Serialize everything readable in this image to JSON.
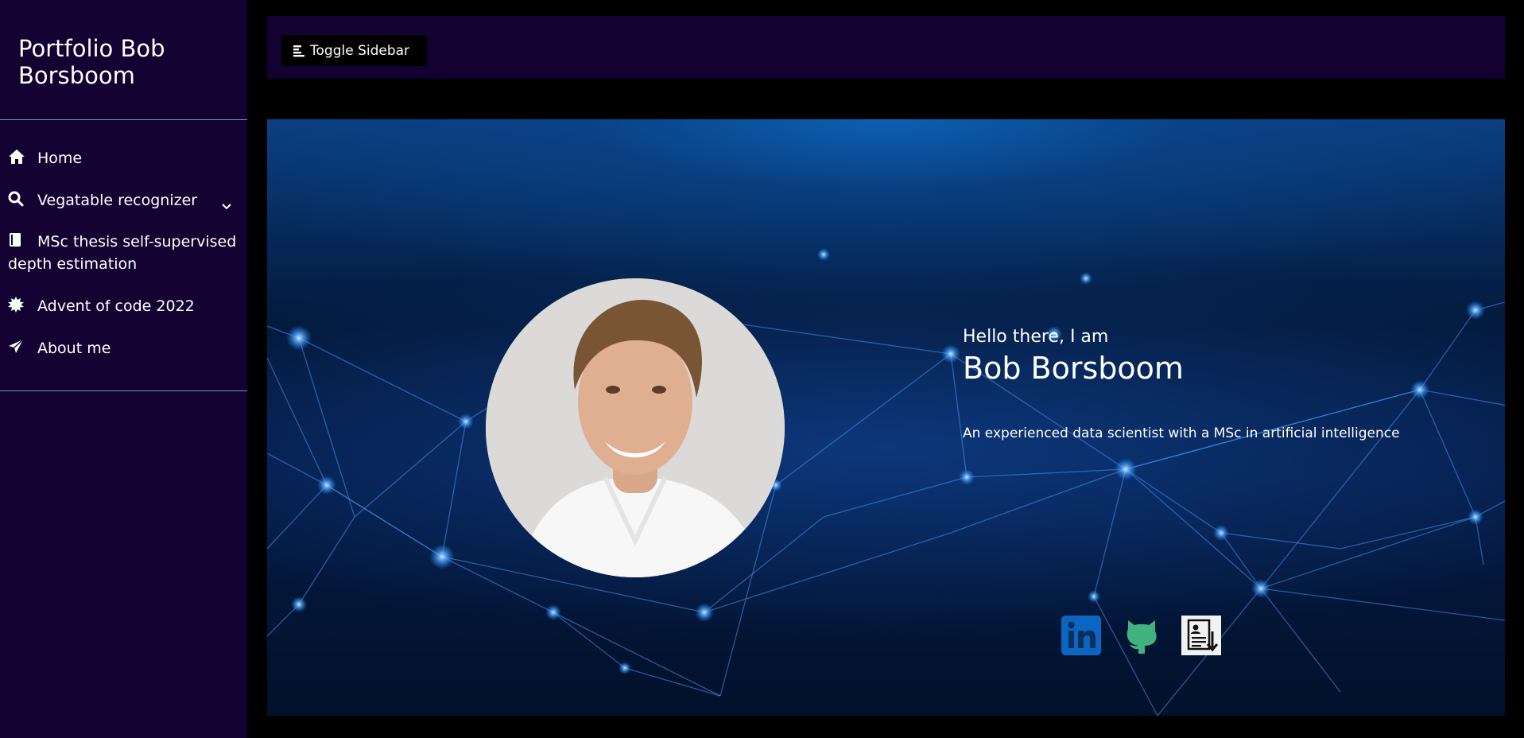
{
  "sidebar": {
    "brand": "Portfolio Bob Borsboom",
    "items": [
      {
        "label": "Home",
        "icon": "home-icon"
      },
      {
        "label": "Vegatable recognizer",
        "icon": "search-icon",
        "has_submenu": true
      },
      {
        "label": "MSc thesis self-supervised depth estimation",
        "icon": "book-icon"
      },
      {
        "label": "Advent of code 2022",
        "icon": "sun-icon"
      },
      {
        "label": "About me",
        "icon": "paper-plane-icon"
      }
    ]
  },
  "topbar": {
    "toggle_label": "Toggle Sidebar"
  },
  "hero": {
    "greeting": "Hello there, I am",
    "name": "Bob Borsboom",
    "tagline": "An experienced data scientist with a MSc in artificial intelligence",
    "social": [
      {
        "icon": "linkedin-icon",
        "color": "#0a66c2"
      },
      {
        "icon": "github-icon",
        "color": "#3fb27f"
      },
      {
        "icon": "resume-download-icon",
        "color": "#ffffff"
      }
    ]
  },
  "colors": {
    "sidebar_bg": "#120131",
    "page_bg": "#000000",
    "accent_blue": "#1e7fe0"
  }
}
